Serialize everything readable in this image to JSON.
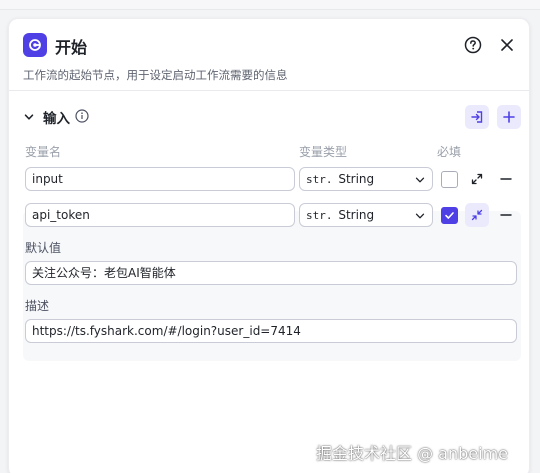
{
  "header": {
    "title": "开始",
    "description": "工作流的起始节点，用于设定启动工作流需要的信息"
  },
  "inputs_section": {
    "title": "输入",
    "columns": {
      "name": "变量名",
      "type": "变量类型",
      "required": "必填"
    },
    "rows": [
      {
        "name": "input",
        "type_prefix": "str.",
        "type": "String",
        "required": false
      },
      {
        "name": "api_token",
        "type_prefix": "str.",
        "type": "String",
        "required": true
      }
    ],
    "expanded": {
      "default_label": "默认值",
      "default_value": "关注公众号：老包AI智能体",
      "desc_label": "描述",
      "desc_value": "https://ts.fyshark.com/#/login?user_id=7414"
    }
  },
  "watermark": "掘金技术社区 @ anbeime",
  "colors": {
    "accent": "#4e40e5",
    "accent_light": "#ebeafd"
  }
}
